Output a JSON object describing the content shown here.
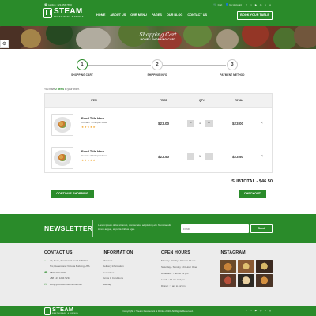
{
  "topbar": {
    "hotline": "Hotline: 123-456-7890",
    "cart": "Cart",
    "account": "My Account",
    "social_icons": [
      "facebook-icon",
      "twitter-icon",
      "youtube-icon",
      "instagram-icon",
      "pinterest-icon",
      "googleplus-icon"
    ]
  },
  "brand": {
    "name": "STEAM",
    "tagline": "RESTAURANT & DRINKS"
  },
  "nav": {
    "items": [
      "HOME",
      "ABOUT US",
      "OUR MENU",
      "PAGES",
      "OUR BLOG",
      "CONTACT US"
    ],
    "book_label": "BOOK YOUR TABLE"
  },
  "hero": {
    "title": "Shopping Cart",
    "breadcrumb": "HOME  /  SHOPPING CART"
  },
  "steps": [
    {
      "number": "1",
      "label": "SHOPPING CART",
      "active": true
    },
    {
      "number": "2",
      "label": "SHIPPING INFO",
      "active": false
    },
    {
      "number": "3",
      "label": "PAYMENT METHOD",
      "active": false
    }
  ],
  "items_note": {
    "prefix": "You have ",
    "count": "2 Items",
    "suffix": " in your order."
  },
  "cart": {
    "headers": {
      "item": "ITEM",
      "price": "PRICE",
      "qty": "QTY.",
      "total": "TOTAL"
    },
    "rows": [
      {
        "title": "Food Title Here",
        "subtitle": "Curnas / Shrimps / Rosa",
        "stars": "★★★★★",
        "price": "$23.00",
        "qty": "1",
        "total": "$23.00"
      },
      {
        "title": "Food Title Here",
        "subtitle": "Curnas / Shrimps / Rosa",
        "stars": "★★★★★",
        "price": "$23.50",
        "qty": "1",
        "total": "$23.50"
      }
    ],
    "subtotal": "SUBTOTAL - $46.50",
    "continue_label": "CONTINUE SHOPPING",
    "checkout_label": "CHECKOUT"
  },
  "newsletter": {
    "title": "NEWSLETTER",
    "text": "Lorem ipsum dolor sit amet, consectetur adipiscing elit. Nunc iaculis lorem augue, at porta finibus eget.",
    "placeholder": "Email",
    "send_label": "Send"
  },
  "footer": {
    "contact": {
      "title": "CONTACT US",
      "lines": [
        {
          "icon": "map-pin-icon",
          "text": "20, Rose, Restaurant Food & Drinks,"
        },
        {
          "icon": "",
          "text": "Nic,Queensland Victoria Building,USA"
        },
        {
          "icon": "phone-icon",
          "text": "1800-000-0000,"
        },
        {
          "icon": "",
          "text": "+88 123 1234 5234"
        },
        {
          "icon": "mail-icon",
          "text": "info@yourdistributorname.com"
        }
      ]
    },
    "information": {
      "title": "INFORMATION",
      "links": [
        "About Us",
        "Delivery Information",
        "Contact us",
        "Terms & Conditions",
        "Sitemap"
      ]
    },
    "hours": {
      "title": "OPEN HOURS",
      "lines": [
        "Monday - Friday : 9 am to 12 am",
        "Saturday - Sunday : 24 Hour Open",
        "Breakfast : 7 am to 12 pm",
        "Lunch : 12 am to 7 pm",
        "Dinner : 7 am to 12 pm"
      ]
    },
    "instagram": {
      "title": "INSTAGRAM"
    }
  },
  "bottombar": {
    "copyright": "Copyright © Steam Restaurant & Drinks 2016, All Rights Reserved."
  },
  "colors": {
    "primary": "#2a8b2a",
    "footer_bg": "#ececec",
    "star": "#f0a020"
  }
}
